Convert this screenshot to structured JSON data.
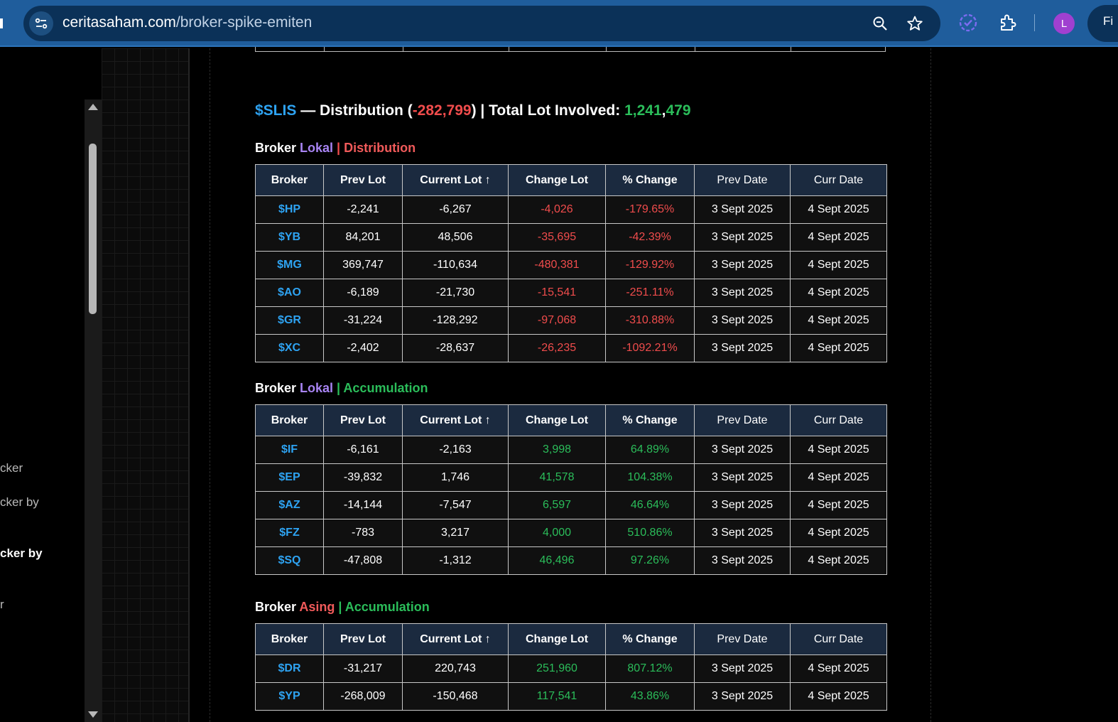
{
  "browser": {
    "url_host": "ceritasaham.com",
    "url_path": "/broker-spike-emiten",
    "profile_initial": "L",
    "right_button_label": "Fi"
  },
  "sidebar": {
    "items": [
      {
        "label": "cker",
        "bold": false
      },
      {
        "label": "cker by",
        "bold": false
      },
      {
        "label": "cker by",
        "bold": true
      },
      {
        "label": "r",
        "bold": false
      }
    ]
  },
  "stock": {
    "ticker": "$SLIS",
    "dash": " — ",
    "status": "Distribution",
    "net_open": " (",
    "net": "-282,799",
    "net_close": ")",
    "total_label": " | Total Lot Involved: ",
    "total_a": "1,241",
    "total_sep": ",",
    "total_b": "479"
  },
  "columns": [
    "Broker",
    "Prev Lot",
    "Current Lot ↑",
    "Change Lot",
    "% Change",
    "Prev Date",
    "Curr Date"
  ],
  "sections": [
    {
      "prefix": "Broker ",
      "group": "Lokal",
      "sep": " | ",
      "kind": "Distribution",
      "rows": [
        [
          "$HP",
          "-2,241",
          "-6,267",
          "-4,026",
          "-179.65%",
          "3 Sept 2025",
          "4 Sept 2025"
        ],
        [
          "$YB",
          "84,201",
          "48,506",
          "-35,695",
          "-42.39%",
          "3 Sept 2025",
          "4 Sept 2025"
        ],
        [
          "$MG",
          "369,747",
          "-110,634",
          "-480,381",
          "-129.92%",
          "3 Sept 2025",
          "4 Sept 2025"
        ],
        [
          "$AO",
          "-6,189",
          "-21,730",
          "-15,541",
          "-251.11%",
          "3 Sept 2025",
          "4 Sept 2025"
        ],
        [
          "$GR",
          "-31,224",
          "-128,292",
          "-97,068",
          "-310.88%",
          "3 Sept 2025",
          "4 Sept 2025"
        ],
        [
          "$XC",
          "-2,402",
          "-28,637",
          "-26,235",
          "-1092.21%",
          "3 Sept 2025",
          "4 Sept 2025"
        ]
      ]
    },
    {
      "prefix": "Broker ",
      "group": "Lokal",
      "sep": " | ",
      "kind": "Accumulation",
      "rows": [
        [
          "$IF",
          "-6,161",
          "-2,163",
          "3,998",
          "64.89%",
          "3 Sept 2025",
          "4 Sept 2025"
        ],
        [
          "$EP",
          "-39,832",
          "1,746",
          "41,578",
          "104.38%",
          "3 Sept 2025",
          "4 Sept 2025"
        ],
        [
          "$AZ",
          "-14,144",
          "-7,547",
          "6,597",
          "46.64%",
          "3 Sept 2025",
          "4 Sept 2025"
        ],
        [
          "$FZ",
          "-783",
          "3,217",
          "4,000",
          "510.86%",
          "3 Sept 2025",
          "4 Sept 2025"
        ],
        [
          "$SQ",
          "-47,808",
          "-1,312",
          "46,496",
          "97.26%",
          "3 Sept 2025",
          "4 Sept 2025"
        ]
      ]
    },
    {
      "prefix": "Broker ",
      "group": "Asing",
      "sep": " | ",
      "kind": "Accumulation",
      "rows": [
        [
          "$DR",
          "-31,217",
          "220,743",
          "251,960",
          "807.12%",
          "3 Sept 2025",
          "4 Sept 2025"
        ],
        [
          "$YP",
          "-268,009",
          "-150,468",
          "117,541",
          "43.86%",
          "3 Sept 2025",
          "4 Sept 2025"
        ]
      ]
    }
  ],
  "colors": {
    "ticker": "#2ea3f2",
    "negative": "#f04c4c",
    "positive": "#2bbd5a",
    "lokal": "#a884f3",
    "asing": "#f05a5a",
    "header_bg": "#1b2a3f"
  }
}
